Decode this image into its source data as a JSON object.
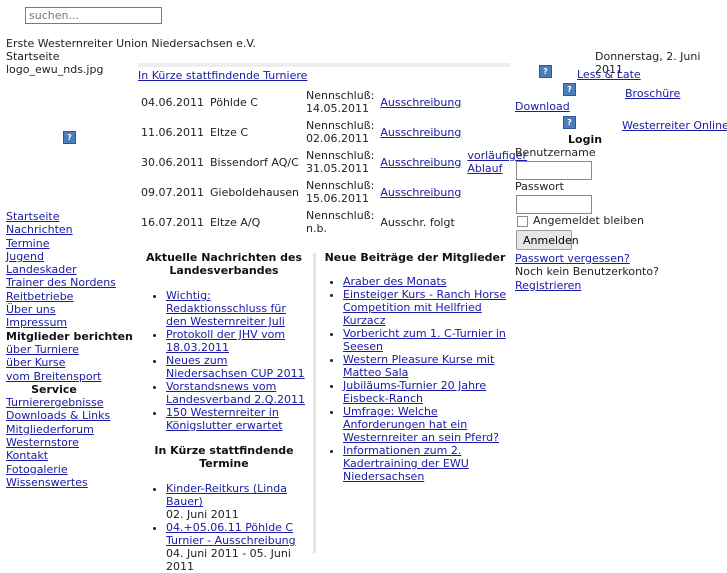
{
  "search": {
    "placeholder": "suchen..."
  },
  "header": {
    "org": "Erste Westernreiter Union Niedersachsen e.V.",
    "crumb": "Startseite",
    "logo_alt": "logo_ewu_nds.jpg",
    "date": "Donnerstag, 2. Juni 2011"
  },
  "tournaments": {
    "title": "In Kürze stattfindende Turniere",
    "rows": [
      {
        "date": "04.06.2011",
        "place": "Pöhlde C",
        "deadline_label": "Nennschluß:",
        "deadline": "14.05.2011",
        "link": "Ausschreibung",
        "extra": ""
      },
      {
        "date": "11.06.2011",
        "place": "Eltze C",
        "deadline_label": "Nennschluß:",
        "deadline": "02.06.2011",
        "link": "Ausschreibung",
        "extra": ""
      },
      {
        "date": "30.06.2011",
        "place": "Bissendorf AQ/C",
        "deadline_label": "Nennschluß:",
        "deadline": "31.05.2011",
        "link": "Ausschreibung",
        "extra": "vorläufiger Ablauf"
      },
      {
        "date": "09.07.2011",
        "place": "Gieboldehausen",
        "deadline_label": "Nennschluß:",
        "deadline": "15.06.2011",
        "link": "Ausschreibung",
        "extra": ""
      },
      {
        "date": "16.07.2011",
        "place": "Eltze A/Q",
        "deadline_label": "Nennschluß:",
        "deadline": "n.b.",
        "link": "",
        "plain": "Ausschr. folgt",
        "extra": ""
      }
    ]
  },
  "left_nav": {
    "items": [
      "Startseite",
      "Nachrichten",
      "Termine",
      "Jugend",
      "Landeskader",
      "Trainer des Nordens",
      "Reitbetriebe",
      "Über uns",
      "Impressum"
    ],
    "heading1": "Mitglieder berichten",
    "items2": [
      "über Turniere",
      "über Kurse",
      "vom Breitensport"
    ],
    "heading2": "Service",
    "items3": [
      "Turnierergebnisse",
      "Downloads & Links",
      "Mitgliederforum",
      "Westernstore",
      "Kontakt",
      "Fotogalerie",
      "Wissenswertes"
    ]
  },
  "news": {
    "title": "Aktuelle Nachrichten des Landesverbandes",
    "items": [
      "Wichtig: Redaktionsschluss für den Westernreiter Juli",
      "Protokoll der JHV vom 18.03.2011",
      "Neues zum Niedersachsen CUP 2011",
      "Vorstandsnews vom Landesverband 2.Q.2011",
      "150 Westernreiter in Königslutter erwartet"
    ]
  },
  "upcoming": {
    "title": "In Kürze stattfindende Termine",
    "items": [
      {
        "link": "Kinder-Reitkurs (Linda Bauer)",
        "date": "02. Juni 2011"
      },
      {
        "link": "04.+05.06.11 Pöhlde C Turnier - Ausschreibung",
        "date": "04. Juni 2011 - 05. Juni 2011"
      }
    ]
  },
  "members": {
    "title": "Neue Beiträge der Mitglieder",
    "items": [
      "Araber des Monats",
      "Einsteiger Kurs - Ranch Horse Competition mit Hellfried Kurzacz",
      "Vorbericht zum 1. C-Turnier in Seesen",
      "Western Pleasure Kurse mit Matteo Sala",
      "Jubiläums-Turnier 20 Jahre Eisbeck-Ranch",
      "Umfrage: Welche Anforderungen hat ein Westernreiter an sein Pferd?",
      "Informationen zum 2. Kadertraining der EWU Niedersachsen"
    ]
  },
  "right": {
    "links": [
      "Less & Late",
      "Broschüre",
      "Download",
      "Westerreiter Online"
    ],
    "login_title": "Login",
    "username_label": "Benutzername",
    "password_label": "Passwort",
    "remember_label": "Angemeldet bleiben",
    "login_button": "Anmelden",
    "forgot": "Passwort vergessen?",
    "no_account": "Noch kein Benutzerkonto?",
    "register": "Registrieren"
  }
}
